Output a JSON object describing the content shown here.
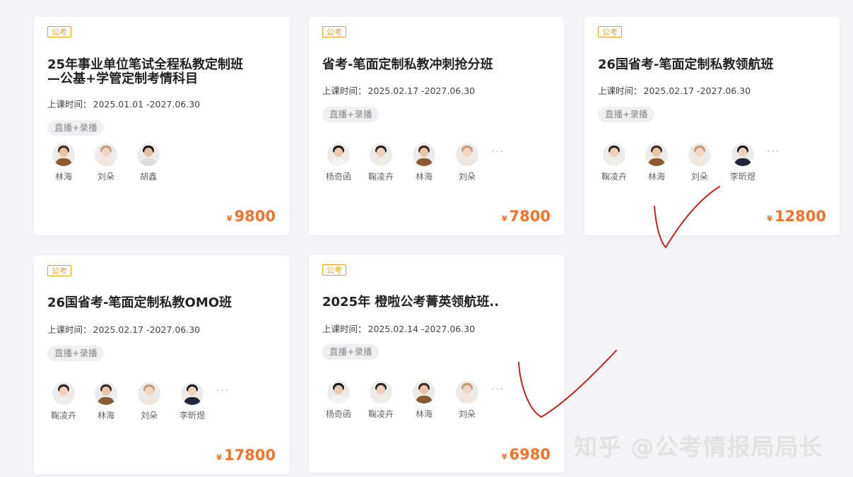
{
  "cards": [
    {
      "badge": "公考",
      "title_line1": "25年事业单位笔试全程私教定制班",
      "title_line2": "—公基+学管定制考情科目",
      "time_label": "上课时间：",
      "time_range": "2025.01.01 -2027.06.30",
      "mode": "直播+录播",
      "teachers": [
        "林海",
        "刘朵",
        "胡鑫"
      ],
      "currency": "¥",
      "price": "9800"
    },
    {
      "badge": "公考",
      "title_line1": "省考-笔面定制私教冲刺抢分班",
      "time_label": "上课时间：",
      "time_range": "2025.02.17 -2027.06.30",
      "mode": "直播+录播",
      "teachers": [
        "杨奇函",
        "鞠凌卉",
        "林海",
        "刘朵"
      ],
      "more": "···",
      "currency": "¥",
      "price": "7800"
    },
    {
      "badge": "公考",
      "title_line1": "26国省考-笔面定制私教领航班",
      "time_label": "上课时间：",
      "time_range": "2025.02.17 -2027.06.30",
      "mode": "直播+录播",
      "teachers": [
        "鞠凌卉",
        "林海",
        "刘朵",
        "李昕煜"
      ],
      "more": "···",
      "currency": "¥",
      "price": "12800"
    },
    {
      "badge": "公考",
      "title_line1": "26国省考-笔面定制私教OMO班",
      "time_label": "上课时间：",
      "time_range": "2025.02.17 -2027.06.30",
      "mode": "直播+录播",
      "teachers": [
        "鞠凌卉",
        "林海",
        "刘朵",
        "李昕煜"
      ],
      "more": "···",
      "currency": "¥",
      "price": "17800"
    },
    {
      "badge": "公考",
      "title_line1": "2025年 橙啦公考菁英领航班..",
      "time_label": "上课时间：",
      "time_range": "2025.02.14 -2027.06.30",
      "mode": "直播+录播",
      "teachers": [
        "杨奇函",
        "鞠凌卉",
        "林海",
        "刘朵"
      ],
      "more": "···",
      "currency": "¥",
      "price": "6980"
    }
  ],
  "watermark": "知乎 @公考情报局局长",
  "colors": {
    "accent": "#f4732a",
    "badge": "#f0a020",
    "annotation": "#c8201c"
  }
}
